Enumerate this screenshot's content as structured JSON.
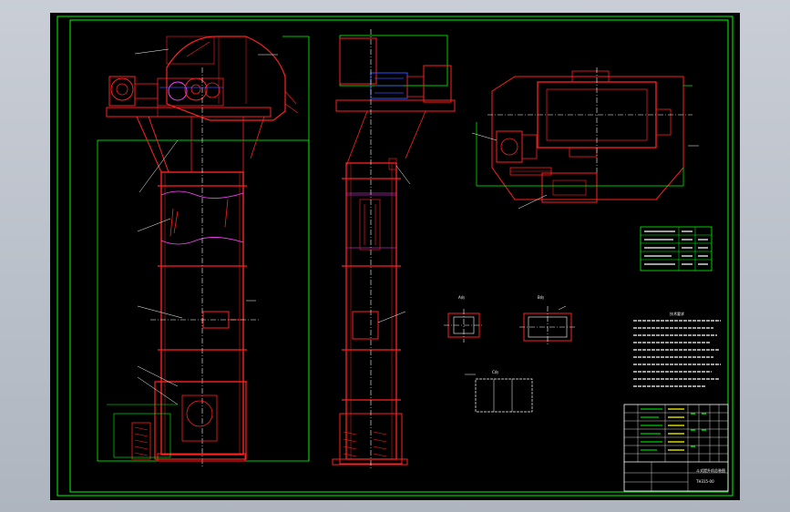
{
  "drawing": {
    "title_block": {
      "name": "斗式提升机总装图",
      "code": "TH315-00"
    },
    "section_labels": {
      "detail_a": "A向",
      "detail_b": "B向",
      "detail_c": "C向",
      "tech_requirements": "技术要求"
    }
  },
  "colors": {
    "background": "#000000",
    "frame": "#00ff00",
    "parts": "#ff2020",
    "text": "#ffffff",
    "dims": "#ffff00",
    "motor": "#3050ff",
    "chain": "#ff40ff"
  },
  "icons": {
    "motor": "motor-icon",
    "reducer": "reducer-icon",
    "hopper": "hopper-icon"
  }
}
